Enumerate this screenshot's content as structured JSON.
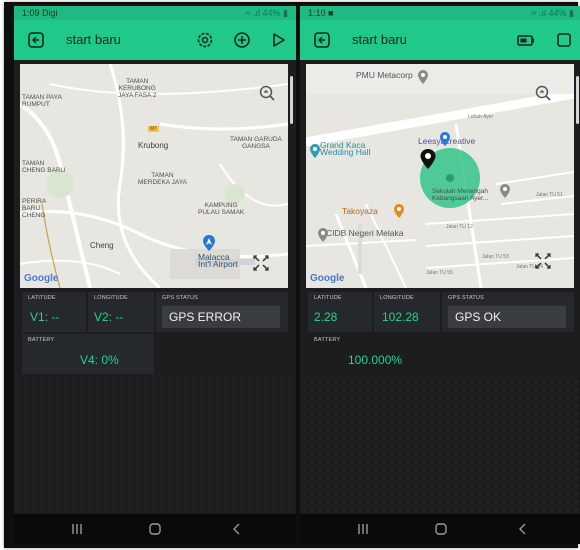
{
  "left": {
    "status": {
      "time": "1:09 Digi",
      "indicators": "≈ .ıl 44% ▮"
    },
    "appbar": {
      "title": "start baru"
    },
    "map": {
      "labels": [
        "TAMAN PAYA\nRUMPUT",
        "TAMAN\nKERUBONG\nJAYA FASA 2",
        "Krubong",
        "TAMAN\nMERDEKA JAYA",
        "TAMAN GARUDA\nGANGSA",
        "TAMAN\nCHENG BARU",
        "PERIRA\nBARU\nCHENG",
        "KAMPUNG\nPULAU SAMAK",
        "Cheng",
        "Malacca\nInt'l Airport"
      ],
      "badges": [
        "M7"
      ],
      "google": "Google"
    },
    "widgets": {
      "latitude": {
        "label": "LATITUDE",
        "value": "V1: --"
      },
      "longitude": {
        "label": "LONGITUDE",
        "value": "V2: --"
      },
      "gps": {
        "label": "GPS STATUS",
        "value": "GPS ERROR"
      },
      "battery": {
        "label": "BATTERY",
        "value": "V4: 0%"
      }
    }
  },
  "right": {
    "status": {
      "time": "1:10 ■",
      "indicators": "≈ .ıl 44% ▮"
    },
    "appbar": {
      "title": "start baru"
    },
    "map": {
      "labels": [
        "PMU Metacorp",
        "Leesyacreative",
        "Grand Kaca\nWedding Hall",
        "Sekolah Menengah\nKebangsaan Ayer...",
        "Takoyaza",
        "CIDB Negeri Melaka"
      ],
      "streets": [
        "Lebuh Ayer",
        "Jalan TU 12",
        "Jalan TU 51",
        "Jalan TU 53",
        "Jalan TU 54",
        "Jalan TU 55"
      ],
      "google": "Google"
    },
    "widgets": {
      "latitude": {
        "label": "LATITUDE",
        "value": "2.28"
      },
      "longitude": {
        "label": "LONGITUDE",
        "value": "102.28"
      },
      "gps": {
        "label": "GPS STATUS",
        "value": "GPS OK"
      },
      "battery": {
        "label": "BATTERY",
        "value": "100.000%"
      }
    }
  },
  "colors": {
    "accent": "#20c989",
    "value": "#22d38f",
    "background": "#1b1d1f",
    "widget": "#26292c"
  },
  "icons": [
    "back-icon",
    "settings-icon",
    "add-icon",
    "play-icon",
    "battery-icon",
    "square-icon",
    "zoom-icon",
    "fullscreen-icon",
    "location-pin-icon",
    "recents-icon",
    "home-icon",
    "back-nav-icon"
  ]
}
